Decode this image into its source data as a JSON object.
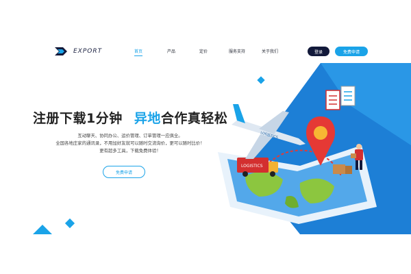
{
  "header": {
    "logo_text": "EXPORT",
    "nav": [
      {
        "label": "首页",
        "active": true
      },
      {
        "label": "产品",
        "active": false
      },
      {
        "label": "定价",
        "active": false
      },
      {
        "label": "服务支持",
        "active": false
      },
      {
        "label": "关于我们",
        "active": false
      }
    ],
    "login_label": "登录",
    "apply_label": "免费申请"
  },
  "hero": {
    "title_part1": "注册下载1分钟",
    "title_highlight": "异地",
    "title_part2": "合作真轻松",
    "desc_lines": [
      "互动聊天、协同办公、运价管理、订单管理一应俱全。",
      "全国各地庄家的通讯录，不用加好友就可以随时交流询价，更可以随时比价！",
      "更有超多工具，下载免费体验！"
    ],
    "cta_label": "免费申请"
  },
  "illustration": {
    "plane_label": "LOGISTICS",
    "truck_label": "LOGISTICS"
  },
  "colors": {
    "accent": "#1aa3e8",
    "dark": "#12193a",
    "highlight": "#1aa3e8"
  }
}
